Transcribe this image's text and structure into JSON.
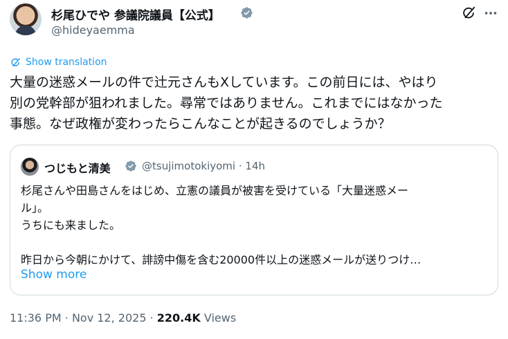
{
  "author": {
    "name": "杉尾ひでや 参議院議員【公式】",
    "handle": "@hideyaemma",
    "verified_color": "#829aab"
  },
  "translation_link": "Show translation",
  "tweet_lines": [
    "大量の迷惑メールの件で辻元さんもXしています。この前日には、やはり",
    "別の党幹部が狙われました。尋常ではありません。これまでにはなかった",
    "事態。なぜ政権が変わったらこんなことが起きるのでしょうか？"
  ],
  "quoted": {
    "name": "つじもと清美",
    "handle": "@tsujimotokiyomi",
    "separator": "·",
    "time": "14h",
    "lines": [
      "杉尾さんや田島さんをはじめ、立憲の議員が被害を受けている「大量迷惑メー",
      "ル」。",
      "うちにも来ました。",
      "",
      "昨日から今朝にかけて、誹謗中傷を含む20000件以上の迷惑メールが送りつけ…"
    ],
    "show_more": "Show more"
  },
  "meta": {
    "time": "11:36 PM",
    "dot1": "·",
    "date": "Nov 12, 2025",
    "dot2": "·",
    "views_count": "220.4K",
    "views_label": "Views"
  },
  "icons": {
    "verified": "verified-badge-icon",
    "grok": "grok-icon",
    "more": "more-icon",
    "translate": "translate-icon"
  },
  "colors": {
    "link": "#1d9bf0",
    "secondary_text": "#536471",
    "border": "#cfd9de"
  }
}
